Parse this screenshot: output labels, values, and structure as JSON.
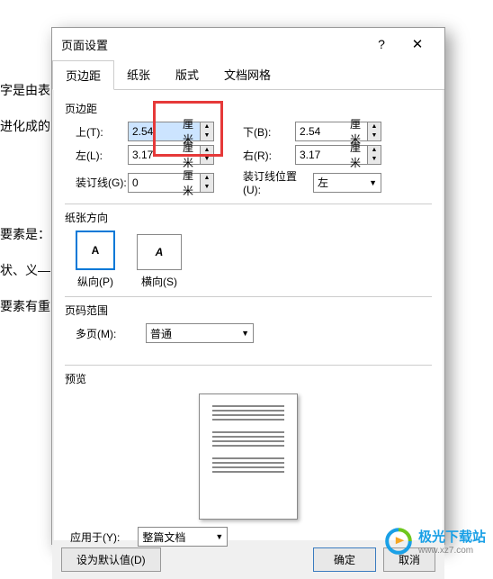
{
  "background_text": {
    "line1": "字是由表",
    "line2": "进化成的",
    "line3": "要素是：",
    "line4": "状、义—",
    "line5": "要素有重"
  },
  "dialog": {
    "title": "页面设置",
    "tabs": {
      "margin": "页边距",
      "paper": "纸张",
      "layout": "版式",
      "grid": "文档网格"
    },
    "group_margin": "页边距",
    "top_label": "上(T):",
    "top_value": "2.54",
    "bottom_label": "下(B):",
    "bottom_value": "2.54",
    "left_label": "左(L):",
    "left_value": "3.17",
    "right_label": "右(R):",
    "right_value": "3.17",
    "unit": "厘米",
    "gutter_label": "装订线(G):",
    "gutter_value": "0",
    "gutter_pos_label": "装订线位置(U):",
    "gutter_pos_value": "左",
    "group_orient": "纸张方向",
    "portrait": "纵向(P)",
    "landscape": "横向(S)",
    "glyph": "A",
    "group_range": "页码范围",
    "multi_label": "多页(M):",
    "multi_value": "普通",
    "group_preview": "预览",
    "apply_label": "应用于(Y):",
    "apply_value": "整篇文档",
    "default_btn": "设为默认值(D)",
    "ok": "确定",
    "cancel": "取消"
  },
  "logo": {
    "cn": "极光下载站",
    "en": "www.xz7.com"
  }
}
